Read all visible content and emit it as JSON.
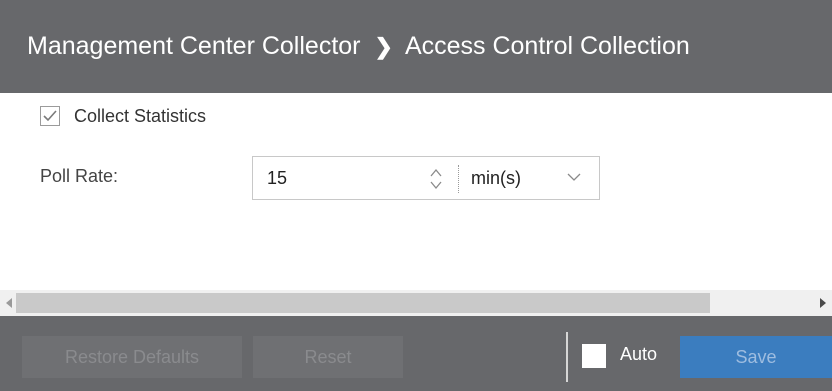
{
  "header": {
    "crumb_parent": "Management Center Collector",
    "separator": "❯",
    "crumb_current": "Access Control Collection"
  },
  "collect_statistics": {
    "label": "Collect Statistics",
    "checked": true
  },
  "poll_rate": {
    "label": "Poll Rate:",
    "value": "15",
    "unit": "min(s)"
  },
  "footer": {
    "restore_defaults_label": "Restore Defaults",
    "reset_label": "Reset",
    "auto_label": "Auto",
    "save_label": "Save"
  },
  "colors": {
    "header_bg": "#67686b",
    "save_bg": "#3b7dbf"
  }
}
